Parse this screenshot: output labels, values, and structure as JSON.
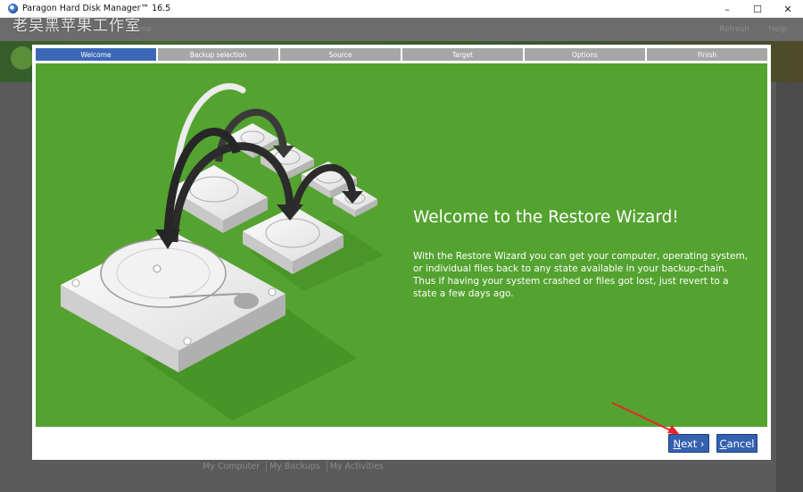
{
  "window": {
    "title": "Paragon Hard Disk Manager™ 16.5",
    "controls": [
      "–",
      "☐",
      "✕"
    ]
  },
  "watermark": "老吴黑苹果工作室",
  "background_app": {
    "top_left_label": "ome",
    "top_right_labels": [
      "Refresh",
      "Help"
    ],
    "bottom_tabs": [
      "My Computer",
      "My Backups",
      "My Activities"
    ]
  },
  "wizard": {
    "steps": [
      {
        "label": "Welcome",
        "active": true
      },
      {
        "label": "Backup selection",
        "active": false
      },
      {
        "label": "Source",
        "active": false
      },
      {
        "label": "Target",
        "active": false
      },
      {
        "label": "Options",
        "active": false
      },
      {
        "label": "Finish",
        "active": false
      }
    ],
    "heading": "Welcome to the Restore Wizard!",
    "description": "With the Restore Wizard you can get your computer, operating system, or individual files back to any state available in your backup-chain. Thus if having your system crashed or files got lost, just revert to a state a few days ago.",
    "buttons": {
      "next_underlined": "N",
      "next_rest": "ext ›",
      "cancel_underlined": "C",
      "cancel_rest": "ancel"
    }
  },
  "colors": {
    "panel_green": "#54a330",
    "step_active": "#3b67b6",
    "step_inactive": "#a6a6a6",
    "button_blue": "#3461b0",
    "annotation_arrow": "#e8242a"
  }
}
